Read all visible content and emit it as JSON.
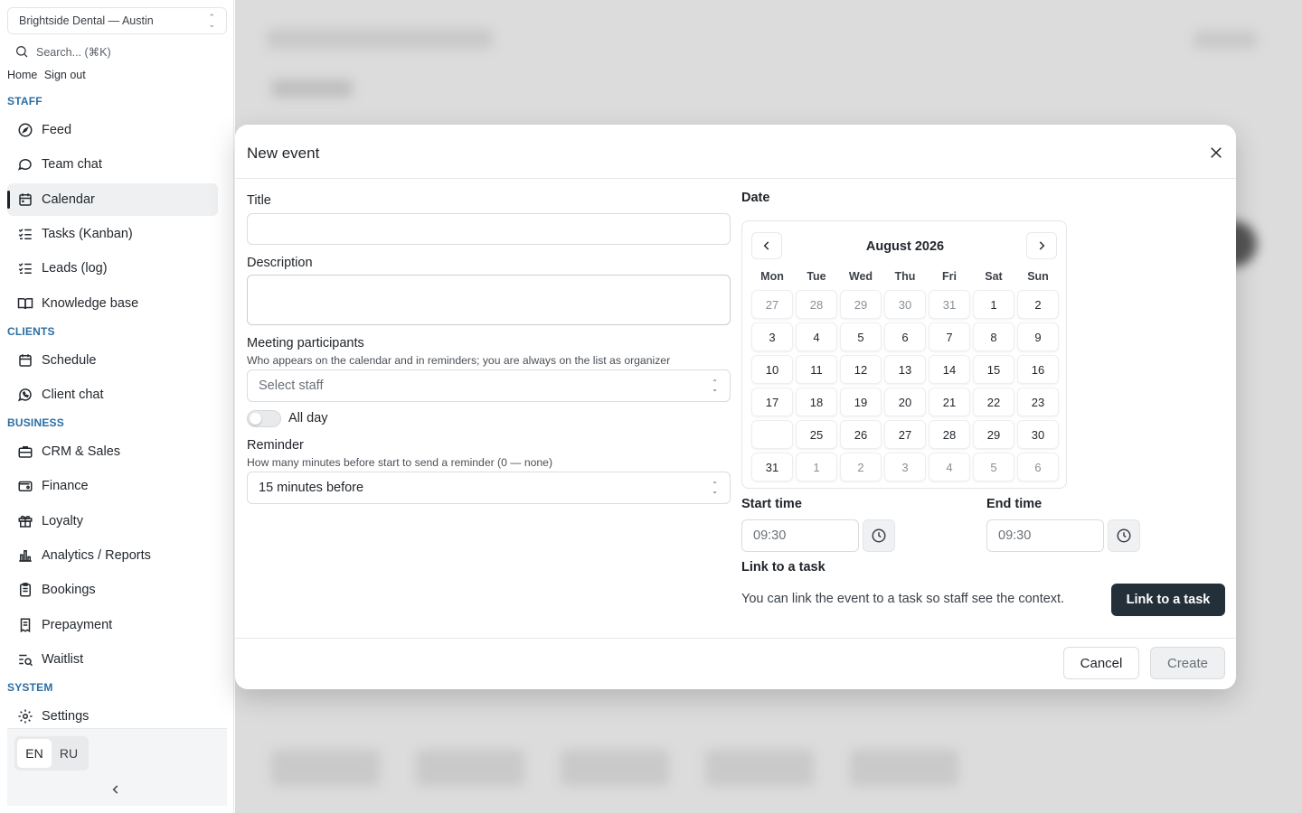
{
  "sidebar": {
    "org": "Brightside Dental — Austin",
    "search_placeholder": "Search... (⌘K)",
    "home": "Home",
    "sign_out": "Sign out",
    "sections": {
      "staff": "STAFF",
      "clients": "CLIENTS",
      "business": "BUSINESS",
      "system": "SYSTEM"
    },
    "items": {
      "feed": "Feed",
      "team_chat": "Team chat",
      "calendar": "Calendar",
      "tasks": "Tasks (Kanban)",
      "leads": "Leads (log)",
      "knowledge": "Knowledge base",
      "schedule": "Schedule",
      "client_chat": "Client chat",
      "crm": "CRM & Sales",
      "finance": "Finance",
      "loyalty": "Loyalty",
      "analytics": "Analytics / Reports",
      "bookings": "Bookings",
      "prepayment": "Prepayment",
      "waitlist": "Waitlist",
      "settings": "Settings"
    },
    "active": "calendar",
    "lang": {
      "en": "EN",
      "ru": "RU",
      "selected": "EN"
    }
  },
  "modal": {
    "title": "New event",
    "title_label": "Title",
    "title_value": "",
    "description_label": "Description",
    "description_value": "",
    "participants_label": "Meeting participants",
    "participants_hint": "Who appears on the calendar and in reminders; you are always on the list as organizer",
    "participants_placeholder": "Select staff",
    "all_day_label": "All day",
    "all_day": false,
    "reminder_label": "Reminder",
    "reminder_hint": "How many minutes before start to send a reminder (0 — none)",
    "reminder_value": "15 minutes before",
    "date_label": "Date",
    "calendar": {
      "month": "August 2026",
      "weekdays": [
        "Mon",
        "Tue",
        "Wed",
        "Thu",
        "Fri",
        "Sat",
        "Sun"
      ],
      "weeks": [
        [
          {
            "d": "27",
            "out": true
          },
          {
            "d": "28",
            "out": true
          },
          {
            "d": "29",
            "out": true
          },
          {
            "d": "30",
            "out": true
          },
          {
            "d": "31",
            "out": true
          },
          {
            "d": "1"
          },
          {
            "d": "2"
          }
        ],
        [
          {
            "d": "3"
          },
          {
            "d": "4"
          },
          {
            "d": "5"
          },
          {
            "d": "6"
          },
          {
            "d": "7"
          },
          {
            "d": "8"
          },
          {
            "d": "9"
          }
        ],
        [
          {
            "d": "10"
          },
          {
            "d": "11"
          },
          {
            "d": "12"
          },
          {
            "d": "13"
          },
          {
            "d": "14"
          },
          {
            "d": "15"
          },
          {
            "d": "16"
          }
        ],
        [
          {
            "d": "17"
          },
          {
            "d": "18"
          },
          {
            "d": "19"
          },
          {
            "d": "20"
          },
          {
            "d": "21"
          },
          {
            "d": "22"
          },
          {
            "d": "23"
          }
        ],
        [
          {
            "d": "",
            "empty": true
          },
          {
            "d": "25"
          },
          {
            "d": "26"
          },
          {
            "d": "27"
          },
          {
            "d": "28"
          },
          {
            "d": "29"
          },
          {
            "d": "30"
          }
        ],
        [
          {
            "d": "31"
          },
          {
            "d": "1",
            "out": true
          },
          {
            "d": "2",
            "out": true
          },
          {
            "d": "3",
            "out": true
          },
          {
            "d": "4",
            "out": true
          },
          {
            "d": "5",
            "out": true
          },
          {
            "d": "6",
            "out": true
          }
        ]
      ]
    },
    "start_time_label": "Start time",
    "start_time": "09:30",
    "end_time_label": "End time",
    "end_time": "09:30",
    "link_label": "Link to a task",
    "link_text": "You can link the event to a task so staff see the context.",
    "link_button": "Link to a task",
    "cancel": "Cancel",
    "create": "Create"
  }
}
